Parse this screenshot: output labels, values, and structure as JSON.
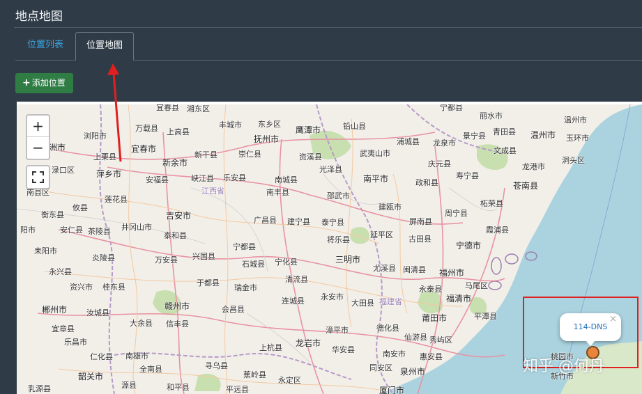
{
  "page": {
    "title": "地点地图"
  },
  "tabs": [
    {
      "label": "位置列表",
      "active": false
    },
    {
      "label": "位置地图",
      "active": true
    }
  ],
  "toolbar": {
    "add_label": "添加位置",
    "add_icon": "plus-icon"
  },
  "map_controls": {
    "zoom_in": "+",
    "zoom_out": "−",
    "fullscreen_icon": "fullscreen-icon"
  },
  "popup": {
    "text": "114-DNS",
    "close": "×"
  },
  "marker": {
    "color": "#e8853a",
    "icon": "location-marker-icon"
  },
  "watermark": "知乎 @何丹",
  "colors": {
    "accent": "#3aa0dd",
    "button": "#2f7d45",
    "highlight": "#e02020",
    "sea": "#aad3df"
  },
  "map_labels": {
    "l1": "宜春县",
    "l2": "湘东区",
    "l3": "东乡区",
    "l4": "宁都县",
    "l5": "丽水市",
    "l6": "万载县",
    "l7": "上高县",
    "l8": "丰城市",
    "l9": "抚州市",
    "l10": "鹰潭市",
    "l11": "铅山县",
    "l12": "景宁县",
    "l13": "青田县",
    "l14": "温州市",
    "l15": "温州市",
    "l16": "株洲市",
    "l17": "浏阳市",
    "l18": "上栗县",
    "l19": "宜春市",
    "l20": "新干县",
    "l21": "崇仁县",
    "l22": "资溪县",
    "l23": "武夷山市",
    "l24": "浦城县",
    "l25": "龙泉市",
    "l26": "文成县",
    "l27": "玉环市",
    "l28": "渌口区",
    "l29": "萍乡市",
    "l30": "新余市",
    "l31": "光泽县",
    "l32": "庆元县",
    "l33": "龙港市",
    "l34": "洞头区",
    "l35": "安福县",
    "l36": "峡江县",
    "l37": "乐安县",
    "l38": "南城县",
    "l39": "南平市",
    "l40": "政和县",
    "l41": "寿宁县",
    "l42": "苍南县",
    "l43": "江西省",
    "l44": "南丰县",
    "l45": "南县区",
    "l46": "莲花县",
    "l47": "邵武市",
    "l48": "柘荣县",
    "l49": "衡东县",
    "l50": "攸县",
    "l51": "吉安市",
    "l52": "广昌县",
    "l53": "建瓯市",
    "l54": "周宁县",
    "l55": "阳市",
    "l56": "安仁县",
    "l57": "茶陵县",
    "l58": "井冈山市",
    "l59": "泰和县",
    "l60": "建宁县",
    "l61": "泰宁县",
    "l62": "屏南县",
    "l63": "霞浦县",
    "l64": "延平区",
    "l65": "古田县",
    "l66": "将乐县",
    "l67": "宁德市",
    "l68": "耒阳市",
    "l69": "炎陵县",
    "l70": "万安县",
    "l71": "兴国县",
    "l72": "宁都县",
    "l73": "三明市",
    "l74": "尤溪县",
    "l75": "石城县",
    "l76": "宁化县",
    "l77": "闽清县",
    "l78": "永兴县",
    "l79": "福州市",
    "l80": "资兴市",
    "l81": "桂东县",
    "l82": "于都县",
    "l83": "瑞金市",
    "l84": "清流县",
    "l85": "永泰县",
    "l86": "马尾区",
    "l87": "郴州市",
    "l88": "汝城县",
    "l89": "赣州市",
    "l90": "会昌县",
    "l91": "连城县",
    "l92": "永安市",
    "l93": "大田县",
    "l94": "福建省",
    "l95": "福清市",
    "l96": "平潭县",
    "l97": "宜章县",
    "l98": "大余县",
    "l99": "信丰县",
    "l100": "莆田市",
    "l101": "漳平市",
    "l102": "德化县",
    "l103": "乐昌市",
    "l104": "仁化县",
    "l105": "南雄市",
    "l106": "上杭县",
    "l107": "龙岩市",
    "l108": "华安县",
    "l109": "仙游县",
    "l110": "秀屿区",
    "l111": "韶关市",
    "l112": "全南县",
    "l113": "寻乌县",
    "l114": "蕉岭县",
    "l115": "南安市",
    "l116": "惠安县",
    "l117": "泉州市",
    "l118": "桃园市",
    "l119": "新竹市",
    "l120": "同安区",
    "l121": "源县",
    "l122": "和平县",
    "l123": "平远县",
    "l124": "永定区",
    "l125": "厦门市",
    "l126": "乳源县"
  }
}
